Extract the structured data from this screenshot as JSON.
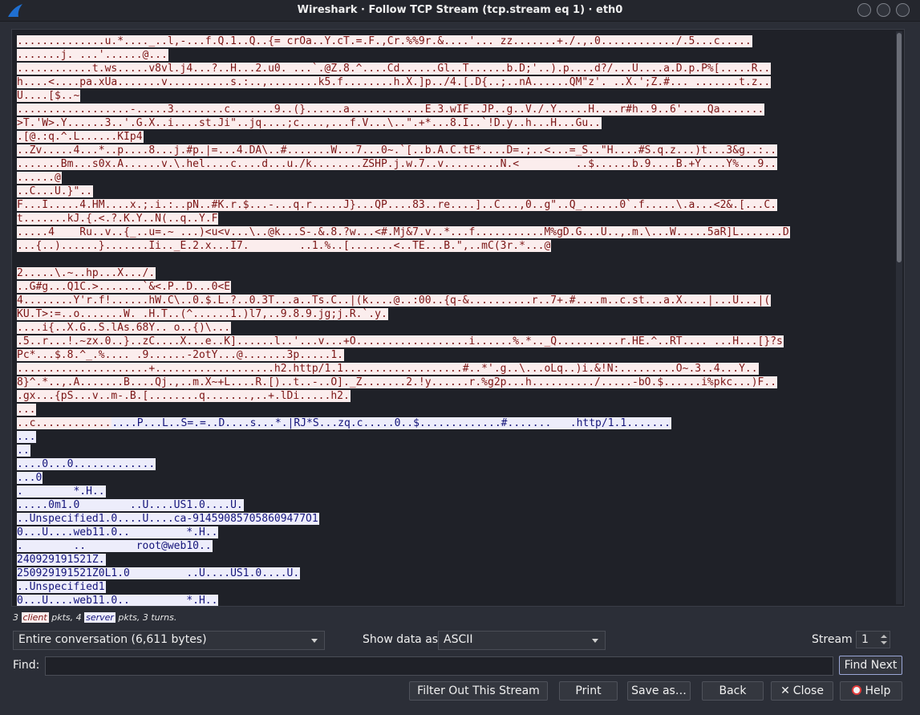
{
  "window": {
    "title": "Wireshark · Follow TCP Stream (tcp.stream eq 1) · eth0"
  },
  "stream_lines": [
    {
      "dir": "client",
      "text": "..............u.*...._..l,-...f.Q.1..Q..{= crOa..Y.cT.=.F.,Cr.%%9r.&....'... zz.......+./.,.0............/.5...c....."
    },
    {
      "dir": "client",
      "text": ".......j. ...'......@..."
    },
    {
      "dir": "client",
      "text": "............t.ws.....v8vl.j4...?..H...2.u0. ...`.@Z.8.^....Cd......Gl..T......b.D;'..).p....d?/...U....a.D.p.P%[.....R.."
    },
    {
      "dir": "client",
      "text": "h....<....pa.xUa.......v..........s.:..,........k5.f........h.X.]p../4.[.D{..;..nA......QM\"z'. ..X.';Z.#... .......t.z.."
    },
    {
      "dir": "client",
      "text": "U....[$..~"
    },
    {
      "dir": "client",
      "text": "..................-.....3........c.......9..(}......a............E.3.wIF..JP..g..V./.Y.....H....r#h..9..6'....Qa......."
    },
    {
      "dir": "client",
      "text": ">T.'W>.Y......3..'.G.X..i....st.Ji\"..jq....;c....,...f.V...\\..\".+*...8.I..`!D.y..h...H...Gu.."
    },
    {
      "dir": "client",
      "text": ".[@.:q.^.L......KIp4"
    },
    {
      "dir": "client",
      "text": "..Zv.....4...*..p....8...j.#p.|=...4.DA\\..#.......W...7...0~.`[..b.A.C.tE*....D=.;..<...=_S..\"H....#S.q.z...)t...3&g..:.."
    },
    {
      "dir": "client",
      "text": ".......Bm...s0x.A......v.\\.hel....c....d...u./k........ZSHP.j.w.7..v.........N.<         ..$......b.9....B.+Y....Y%...9.."
    },
    {
      "dir": "client",
      "text": "......@"
    },
    {
      "dir": "client",
      "text": "..C...U.}\".."
    },
    {
      "dir": "client",
      "text": "F...I.....4.HM....x.;.i.:..pN..#K.r.$...-...q.r.....J}...QP....83..re....]..C...,0..g\"..Q_......0`.f.....\\.a...<2&.[...C."
    },
    {
      "dir": "client",
      "text": "t.......kJ.{.<.?.K.Y..N(..q..Y.F"
    },
    {
      "dir": "client",
      "text": ".....4    Ru..v..{_..u=.~ ...)<u<v...\\..@k...S-.&.8.?w...<#.Mj&7.v..*...f...........M%gD.G...U..,.m.\\...W.....5aR]L.......D"
    },
    {
      "dir": "client",
      "text": "...{..)......}.......Ii.._E.2.x...I7.        ..1.%..[.......<..TE...B.\",..mC(3r.*...@"
    },
    {
      "dir": "blank",
      "text": ""
    },
    {
      "dir": "client",
      "text": "2.....\\.~..hp...X.../."
    },
    {
      "dir": "client",
      "text": "..G#g...Q1C.>.......`&<.P..D...0<E"
    },
    {
      "dir": "client",
      "text": "4........Y'r.f!......hW.C\\..0.$.L.?..0.3T...a..Ts.C..|(k....@..:00..{q-&..........r..7+.#....m..c.st...a.X....|...U...|("
    },
    {
      "dir": "client",
      "text": "KU.T>:=..o.......W. .H.T..(^......1.)l7,..9.8.9.jg;j.R.`.y."
    },
    {
      "dir": "client",
      "text": "....i{..X.G..S.lAs.68Y.. o..{)\\..."
    },
    {
      "dir": "client",
      "text": ".5..r...!.~zx.0..}..zC....X...e..K]......l..'...v...+O..................i......%.*.._Q..........r.HE.^..RT.... ...H...[}?s"
    },
    {
      "dir": "client",
      "text": "Pc*...$.8.^_.%.... .9......-2otY...@.......3p.....1."
    },
    {
      "dir": "client",
      "text": ".....................+...................h2.http/1.1...................#..*'.g..\\...oLq..)i.&!N:.........O~.3..4...Y.."
    },
    {
      "dir": "client",
      "text": "8}^.*..,.A.......B....Qj.,..m.X~+L....R.[)..t..-..O]._Z.......2.!y......r.%g2p...h........../.....-bO.$......i%pkc...)F.."
    },
    {
      "dir": "client",
      "text": ".gx...{pS...v..m-.B.[........q.......,..+.lDi.....h2."
    },
    {
      "dir": "client",
      "text": "..."
    },
    {
      "dir": "mixed",
      "client": "..c............",
      "server": "....P...L..S=.=..D....s...*.|RJ*S...zq.c.....0..$.............#.......   .http/1.1......."
    },
    {
      "dir": "server",
      "text": "..."
    },
    {
      "dir": "server",
      "text": ".."
    },
    {
      "dir": "server",
      "text": "....0...0............."
    },
    {
      "dir": "server",
      "text": "...0"
    },
    {
      "dir": "server",
      "text": ".        *.H.."
    },
    {
      "dir": "server",
      "text": ".....0m1.0        ..U....US1.0....U."
    },
    {
      "dir": "server",
      "text": "..Unspecified1.0....U....ca-914590857058609477O1"
    },
    {
      "dir": "server",
      "text": "0...U....web11.0..         *.H.."
    },
    {
      "dir": "server",
      "text": ".        ..        root@web10.."
    },
    {
      "dir": "server",
      "text": "240929191521Z."
    },
    {
      "dir": "server",
      "text": "250929191521Z0L1.0         ..U....US1.0....U."
    },
    {
      "dir": "server",
      "text": "..Unspecified1"
    },
    {
      "dir": "server",
      "text": "0...U....web11.0..         *.H.."
    }
  ],
  "summary": {
    "pre": "3 ",
    "client": "client",
    "mid": " pkts, 4 ",
    "server": "server",
    "post": " pkts, 3 turns."
  },
  "conversation": {
    "value": "Entire conversation (6,611 bytes)"
  },
  "show_data": {
    "label": "Show data as",
    "value": "ASCII"
  },
  "stream": {
    "label": "Stream",
    "value": "1"
  },
  "find": {
    "label": "Find:",
    "value": "",
    "button": "Find Next"
  },
  "buttons": {
    "filter_out": "Filter Out This Stream",
    "print": "Print",
    "save_as": "Save as…",
    "back": "Back",
    "close": "Close",
    "help": "Help"
  }
}
